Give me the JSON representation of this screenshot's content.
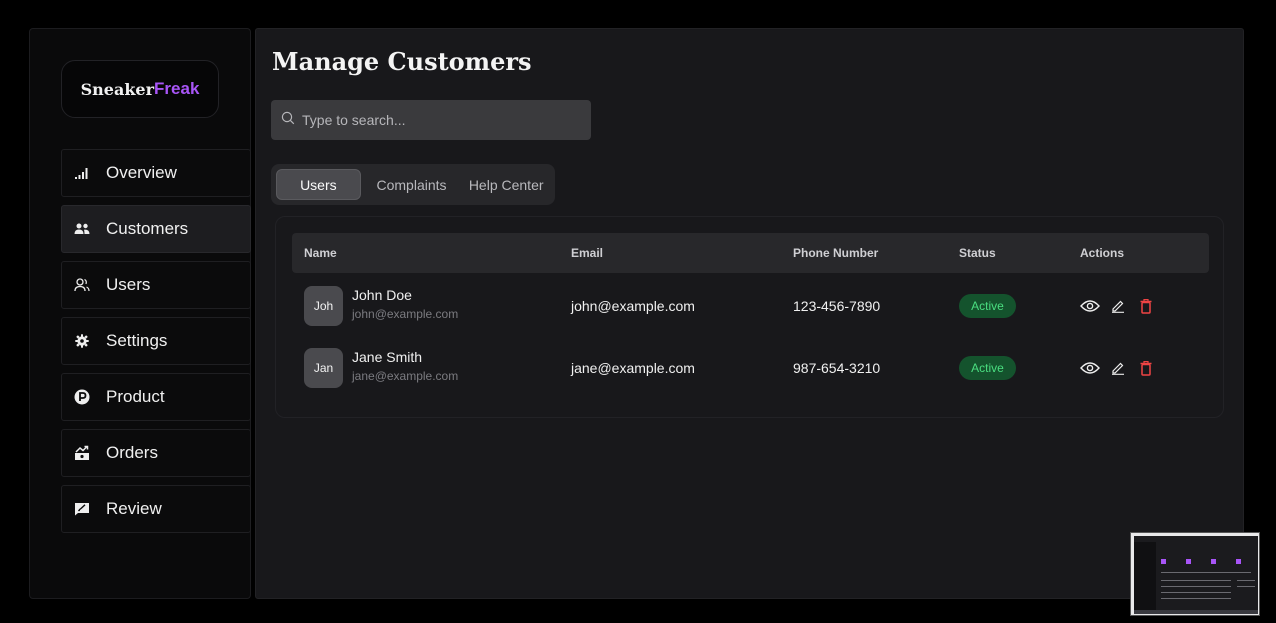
{
  "brand": {
    "part1": "Sneaker",
    "part2": "Freak",
    "accent_color": "#a855f7"
  },
  "sidebar": {
    "items": [
      {
        "label": "Overview",
        "icon": "signal-bars-icon"
      },
      {
        "label": "Customers",
        "icon": "users-group-icon",
        "active": true
      },
      {
        "label": "Users",
        "icon": "user-outline-icon"
      },
      {
        "label": "Settings",
        "icon": "gear-icon"
      },
      {
        "label": "Product",
        "icon": "product-p-icon"
      },
      {
        "label": "Orders",
        "icon": "orders-money-icon"
      },
      {
        "label": "Review",
        "icon": "review-chat-icon"
      }
    ]
  },
  "main": {
    "title": "Manage Customers",
    "search": {
      "placeholder": "Type to search...",
      "value": ""
    },
    "tabs": [
      {
        "label": "Users",
        "active": true
      },
      {
        "label": "Complaints"
      },
      {
        "label": "Help Center"
      }
    ],
    "table": {
      "headers": [
        "Name",
        "Email",
        "Phone Number",
        "Status",
        "Actions"
      ],
      "rows": [
        {
          "initials": "Joh",
          "name": "John Doe",
          "sub_email": "john@example.com",
          "email": "john@example.com",
          "phone": "123-456-7890",
          "status": "Active"
        },
        {
          "initials": "Jan",
          "name": "Jane Smith",
          "sub_email": "jane@example.com",
          "email": "jane@example.com",
          "phone": "987-654-3210",
          "status": "Active"
        }
      ]
    }
  },
  "colors": {
    "status_active_text": "#4ade80",
    "status_active_bg": "#14532d",
    "delete": "#ef4444"
  }
}
